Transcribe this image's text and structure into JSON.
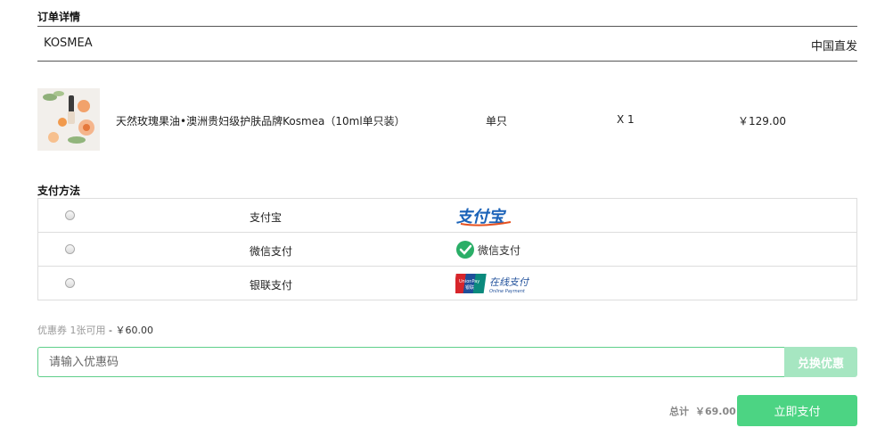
{
  "order": {
    "section_title": "订单详情",
    "shop_name": "KOSMEA",
    "shipping": "中国直发",
    "item": {
      "name": "天然玫瑰果油•澳洲贵妇级护肤品牌Kosmea（10ml单只装）",
      "spec": "单只",
      "qty": "X 1",
      "price": "￥129.00"
    }
  },
  "payment": {
    "section_title": "支付方法",
    "methods": [
      {
        "label": "支付宝",
        "logo_text": "支付宝",
        "logo_color": "#1a62b8",
        "accent": "#e5501f"
      },
      {
        "label": "微信支付",
        "logo_text": "微信支付",
        "logo_color": "#2aae67"
      },
      {
        "label": "银联支付",
        "logo_text": "在线支付",
        "logo_sub": "Online Payment",
        "logo_color": "#1f4f9a",
        "union_text": "UnionPay",
        "union_cn": "银联"
      }
    ]
  },
  "coupon": {
    "label": "优惠券 1张可用",
    "amount": "- ￥60.00",
    "placeholder": "请输入优惠码",
    "button": "兑换优惠"
  },
  "summary": {
    "total_label": "总计",
    "total_value": "￥69.00",
    "pay_button": "立即支付"
  },
  "colors": {
    "primary_green": "#4cd483",
    "light_green": "#a6e6c1"
  }
}
